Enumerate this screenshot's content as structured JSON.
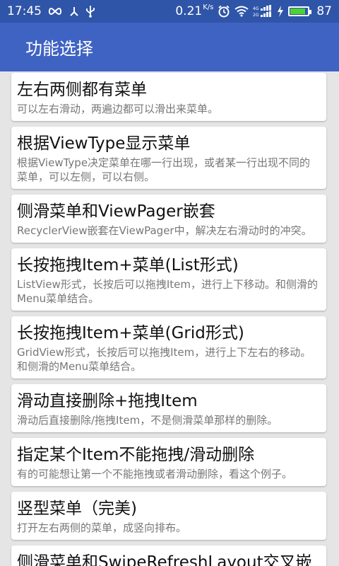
{
  "status_bar": {
    "time": "17:45",
    "net_speed": "0.21",
    "net_speed_unit": "K/s",
    "battery": "87",
    "battery_level_percent": 87
  },
  "app_bar": {
    "title": "功能选择"
  },
  "items": [
    {
      "title": "左右两侧都有菜单",
      "desc": "可以左右滑动，两遍边都可以滑出来菜单。"
    },
    {
      "title": "根据ViewType显示菜单",
      "desc": "根据ViewType决定菜单在哪一行出现，或者某一行出现不同的菜单，可以左侧，可以右侧。"
    },
    {
      "title": "侧滑菜单和ViewPager嵌套",
      "desc": "RecyclerView嵌套在ViewPager中，解决左右滑动时的冲突。"
    },
    {
      "title": "长按拖拽Item+菜单(List形式)",
      "desc": "ListView形式，长按后可以拖拽Item，进行上下移动。和侧滑的Menu菜单结合。"
    },
    {
      "title": "长按拖拽Item+菜单(Grid形式)",
      "desc": "GridView形式，长按后可以拖拽Item，进行上下左右的移动。和侧滑的Menu菜单结合。"
    },
    {
      "title": "滑动直接删除+拖拽Item",
      "desc": "滑动后直接删除/拖拽Item，不是侧滑菜单那样的删除。"
    },
    {
      "title": "指定某个Item不能拖拽/滑动删除",
      "desc": "有的可能想让第一个不能拖拽或者滑动删除，看这个例子。"
    },
    {
      "title": "竖型菜单（完美)",
      "desc": "打开左右两侧的菜单，成竖向排布。"
    },
    {
      "title": "侧滑菜单和SwipeRefreshLayout交叉嵌",
      "desc": ""
    }
  ],
  "colors": {
    "status_bar": "#2f55a9",
    "app_bar": "#3f63c3",
    "background": "#e5e5e5",
    "battery_fill": "#4cd137"
  },
  "icons": [
    "infinity-icon",
    "usb-debug-icon",
    "usb-icon",
    "alarm-icon",
    "wifi-icon",
    "signal-icon",
    "charging-icon",
    "battery-icon"
  ]
}
